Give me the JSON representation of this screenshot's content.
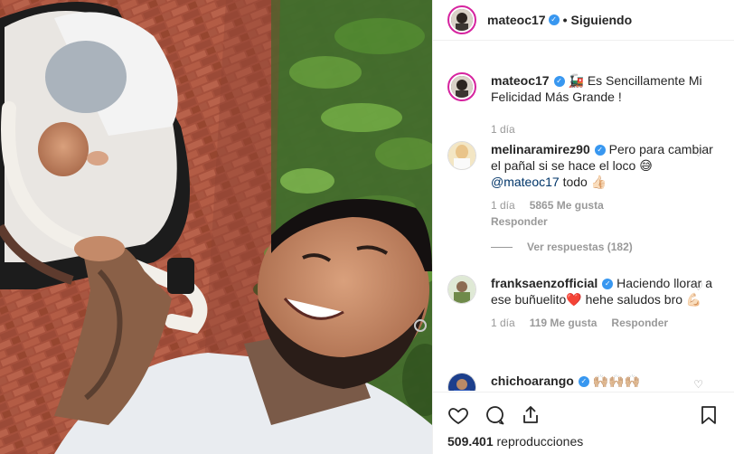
{
  "post": {
    "author": "mateoc17",
    "follow_status": "Siguiendo",
    "separator": "•",
    "more_label": "•••"
  },
  "caption": {
    "username": "mateoc17",
    "emoji": "🚂",
    "text": "Es Sencillamente Mi Felicidad Más Grande !",
    "time": "1 día"
  },
  "comments": [
    {
      "username": "melinaramirez90",
      "text_before": "Pero para cambiar el pañal si se hace el loco 😅 ",
      "mention": "@mateoc17",
      "text_after": " todo 👍🏻",
      "time": "1 día",
      "likes": "5865 Me gusta",
      "reply": "Responder",
      "view_replies": "Ver respuestas (182)"
    },
    {
      "username": "franksaenzofficial",
      "text": "Haciendo llorar a ese buñuelito❤️ hehe saludos bro 💪🏻",
      "time": "1 día",
      "likes": "119 Me gusta",
      "reply": "Responder"
    },
    {
      "username": "chichoarango",
      "text": "🙌🏼🙌🏼🙌🏼"
    }
  ],
  "actions": {
    "views_count": "509.401",
    "views_label": "reproducciones"
  },
  "colors": {
    "verified": "#3897f0",
    "story_ring": "#d6249f",
    "muted": "#999999",
    "link": "#003569"
  },
  "icons": [
    "verified-icon",
    "heart-icon",
    "comment-icon",
    "share-icon",
    "bookmark-icon",
    "more-options-icon"
  ]
}
